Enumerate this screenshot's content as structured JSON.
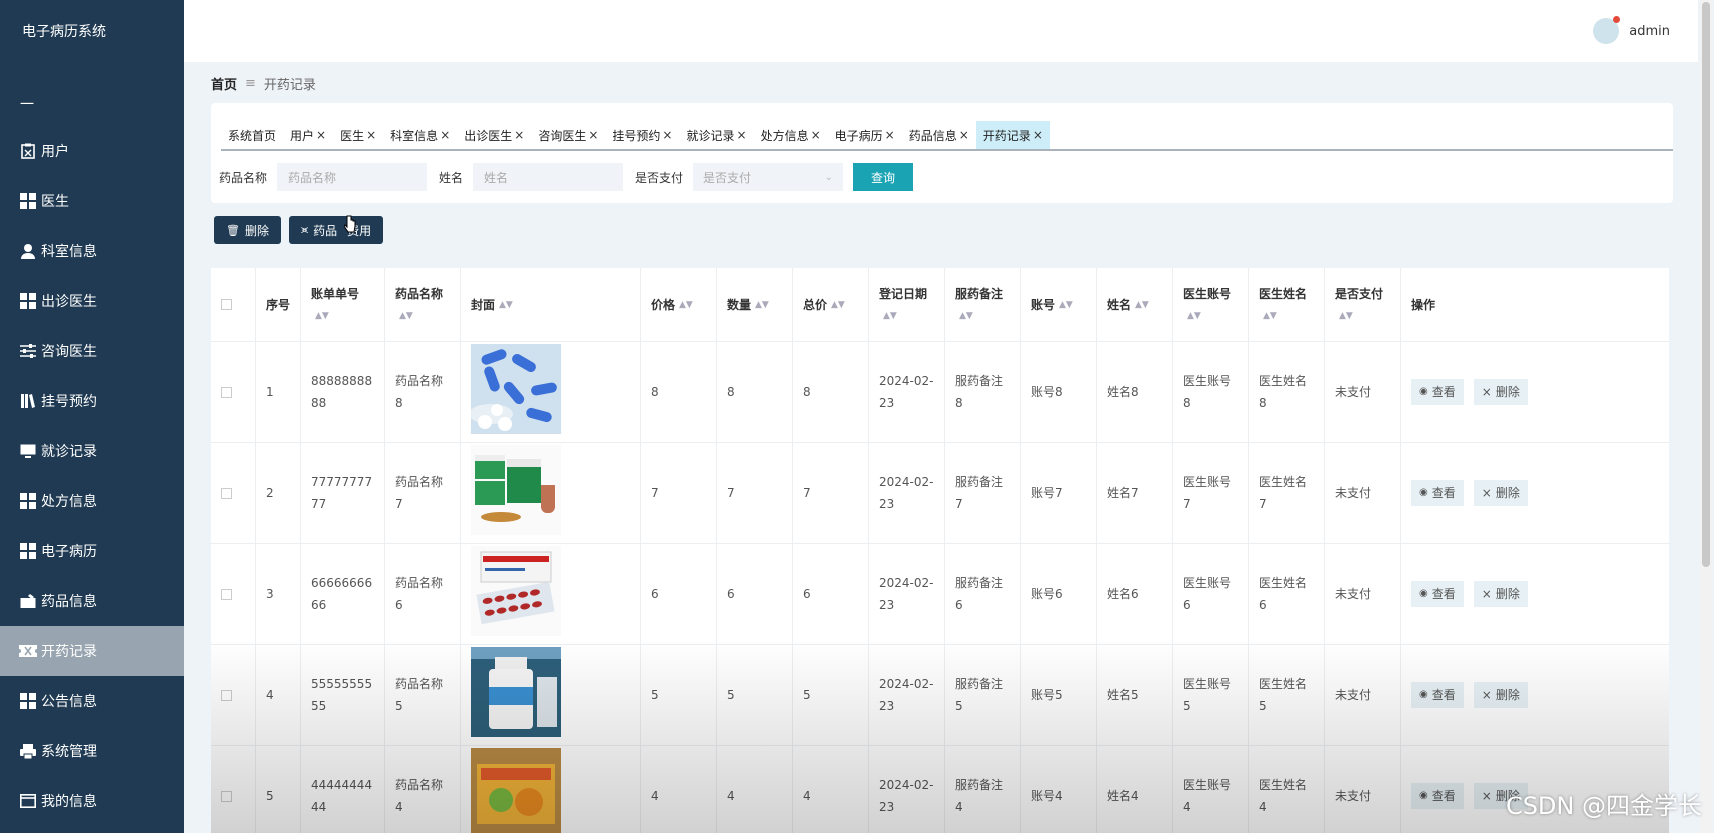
{
  "app": {
    "title": "电子病历系统"
  },
  "sidebar": {
    "dash": "一",
    "items": [
      {
        "label": "用户",
        "icon": "clipboard-icon"
      },
      {
        "label": "医生",
        "icon": "grid-icon"
      },
      {
        "label": "科室信息",
        "icon": "person-icon"
      },
      {
        "label": "出诊医生",
        "icon": "grid-icon"
      },
      {
        "label": "咨询医生",
        "icon": "sliders-icon"
      },
      {
        "label": "挂号预约",
        "icon": "book-icon"
      },
      {
        "label": "就诊记录",
        "icon": "monitor-icon"
      },
      {
        "label": "处方信息",
        "icon": "grid-icon"
      },
      {
        "label": "电子病历",
        "icon": "grid-icon"
      },
      {
        "label": "药品信息",
        "icon": "briefcase-icon"
      },
      {
        "label": "开药记录",
        "icon": "ticket-icon"
      },
      {
        "label": "公告信息",
        "icon": "grid-icon"
      },
      {
        "label": "系统管理",
        "icon": "printer-icon"
      },
      {
        "label": "我的信息",
        "icon": "window-icon"
      }
    ]
  },
  "header": {
    "user": "admin"
  },
  "breadcrumb": {
    "home": "首页",
    "sep": "≡",
    "current": "开药记录"
  },
  "tabs": [
    {
      "label": "系统首页",
      "close": ""
    },
    {
      "label": "用户",
      "close": "×"
    },
    {
      "label": "医生",
      "close": "×"
    },
    {
      "label": "科室信息",
      "close": "×"
    },
    {
      "label": "出诊医生",
      "close": "×"
    },
    {
      "label": "咨询医生",
      "close": "×"
    },
    {
      "label": "挂号预约",
      "close": "×"
    },
    {
      "label": "就诊记录",
      "close": "×"
    },
    {
      "label": "处方信息",
      "close": "×"
    },
    {
      "label": "电子病历",
      "close": "×"
    },
    {
      "label": "药品信息",
      "close": "×"
    },
    {
      "label": "开药记录",
      "close": "×"
    }
  ],
  "search": {
    "drug_label": "药品名称",
    "drug_placeholder": "药品名称",
    "name_label": "姓名",
    "name_placeholder": "姓名",
    "paid_label": "是否支付",
    "paid_placeholder": "是否支付",
    "query": "查询"
  },
  "toolbar": {
    "delete": "删除",
    "fee_a": "药品",
    "fee_b": "费用"
  },
  "table": {
    "headers": [
      "序号",
      "账单单号",
      "药品名称",
      "封面",
      "价格",
      "数量",
      "总价",
      "登记日期",
      "服药备注",
      "账号",
      "姓名",
      "医生账号",
      "医生姓名",
      "是否支付",
      "操作"
    ],
    "view": "查看",
    "del": "删除",
    "rows": [
      {
        "idx": "1",
        "bill1": "88888888",
        "bill2": "88",
        "drug1": "药品名称",
        "drug2": "8",
        "price": "8",
        "qty": "8",
        "total": "8",
        "date1": "2024-02-",
        "date2": "23",
        "note1": "服药备注",
        "note2": "8",
        "acct": "账号8",
        "name": "姓名8",
        "dacct1": "医生账号",
        "dacct2": "8",
        "dname1": "医生姓名",
        "dname2": "8",
        "paid": "未支付",
        "img": "blue-pills"
      },
      {
        "idx": "2",
        "bill1": "77777777",
        "bill2": "77",
        "drug1": "药品名称",
        "drug2": "7",
        "price": "7",
        "qty": "7",
        "total": "7",
        "date1": "2024-02-",
        "date2": "23",
        "note1": "服药备注",
        "note2": "7",
        "acct": "账号7",
        "name": "姓名7",
        "dacct1": "医生账号",
        "dacct2": "7",
        "dname1": "医生姓名",
        "dname2": "7",
        "paid": "未支付",
        "img": "green-boxes"
      },
      {
        "idx": "3",
        "bill1": "66666666",
        "bill2": "66",
        "drug1": "药品名称",
        "drug2": "6",
        "price": "6",
        "qty": "6",
        "total": "6",
        "date1": "2024-02-",
        "date2": "23",
        "note1": "服药备注",
        "note2": "6",
        "acct": "账号6",
        "name": "姓名6",
        "dacct1": "医生账号",
        "dacct2": "6",
        "dname1": "医生姓名",
        "dname2": "6",
        "paid": "未支付",
        "img": "blister-pack"
      },
      {
        "idx": "4",
        "bill1": "55555555",
        "bill2": "55",
        "drug1": "药品名称",
        "drug2": "5",
        "price": "5",
        "qty": "5",
        "total": "5",
        "date1": "2024-02-",
        "date2": "23",
        "note1": "服药备注",
        "note2": "5",
        "acct": "账号5",
        "name": "姓名5",
        "dacct1": "医生账号",
        "dacct2": "5",
        "dname1": "医生姓名",
        "dname2": "5",
        "paid": "未支付",
        "img": "bottle"
      },
      {
        "idx": "5",
        "bill1": "44444444",
        "bill2": "44",
        "drug1": "药品名称",
        "drug2": "4",
        "price": "4",
        "qty": "4",
        "total": "4",
        "date1": "2024-02-",
        "date2": "23",
        "note1": "服药备注",
        "note2": "4",
        "acct": "账号4",
        "name": "姓名4",
        "dacct1": "医生账号",
        "dacct2": "4",
        "dname1": "医生姓名",
        "dname2": "4",
        "paid": "未支付",
        "img": "orange-box"
      }
    ]
  },
  "watermark": "CSDN @四金学长"
}
